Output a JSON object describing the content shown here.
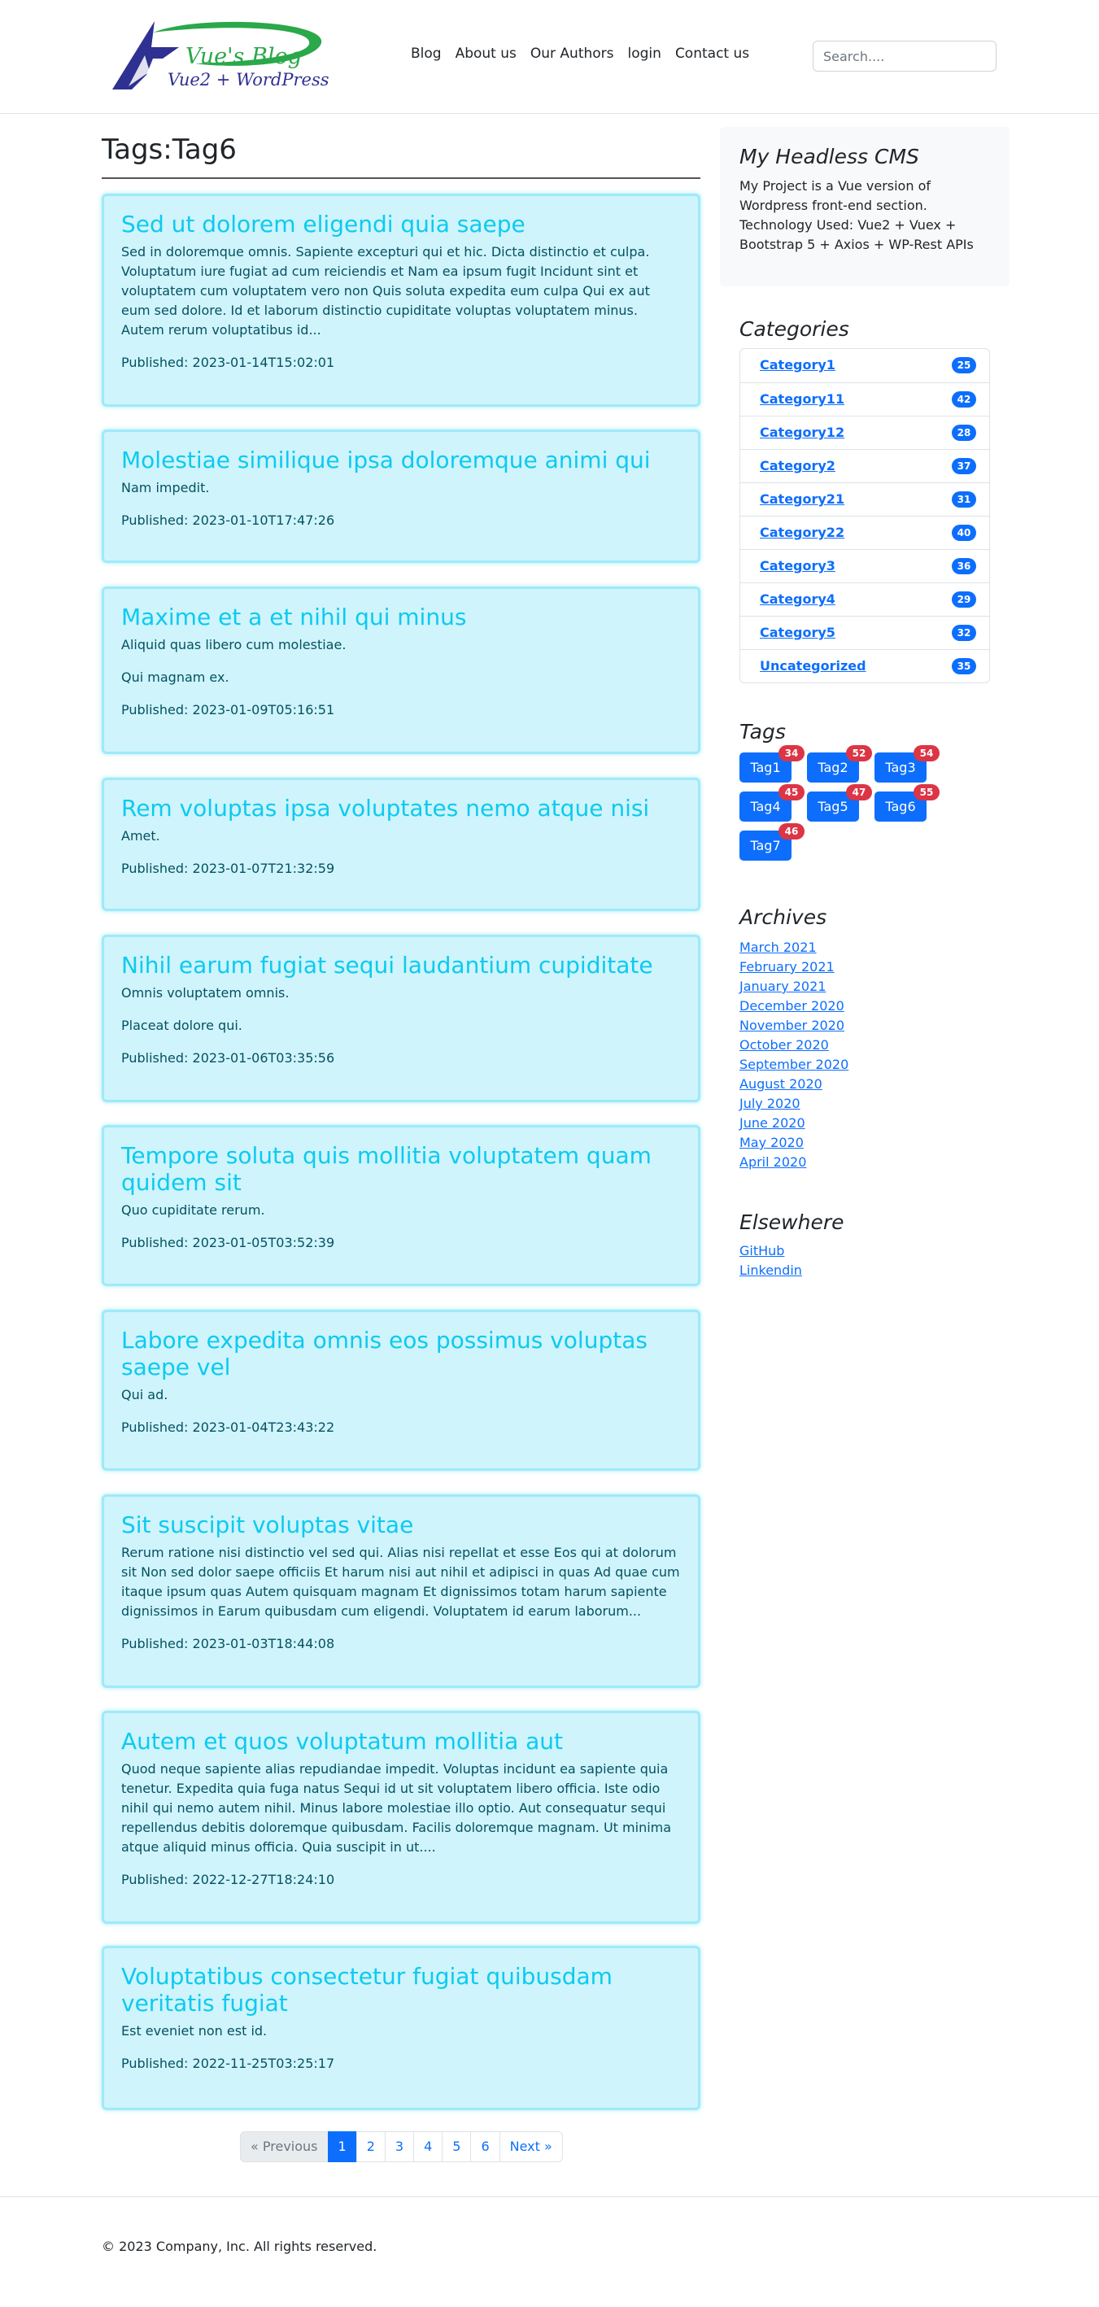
{
  "header": {
    "logo_title": "Vue's Blog",
    "logo_subtitle": "Vue2 + WordPress",
    "nav": [
      "Blog",
      "About us",
      "Our Authors",
      "login",
      "Contact us"
    ],
    "search_placeholder": "Search...."
  },
  "main": {
    "page_title": "Tags:Tag6",
    "posts": [
      {
        "title": "Sed ut dolorem eligendi quia saepe",
        "paragraphs": [
          "Sed in doloremque omnis. Sapiente excepturi qui et hic. Dicta distinctio et culpa. Voluptatum iure fugiat ad cum reiciendis et Nam ea ipsum fugit Incidunt sint et voluptatem cum voluptatem vero non Quis soluta expedita eum culpa Qui ex aut eum sed dolore. Id et laborum distinctio cupiditate voluptas voluptatem minus. Autem rerum voluptatibus id..."
        ],
        "published": "Published: 2023-01-14T15:02:01"
      },
      {
        "title": "Molestiae similique ipsa doloremque animi qui",
        "paragraphs": [
          "Nam impedit."
        ],
        "published": "Published: 2023-01-10T17:47:26"
      },
      {
        "title": "Maxime et a et nihil qui minus",
        "paragraphs": [
          "Aliquid quas libero cum molestiae.",
          "Qui magnam ex."
        ],
        "published": "Published: 2023-01-09T05:16:51"
      },
      {
        "title": "Rem voluptas ipsa voluptates nemo atque nisi",
        "paragraphs": [
          "Amet."
        ],
        "published": "Published: 2023-01-07T21:32:59"
      },
      {
        "title": "Nihil earum fugiat sequi laudantium cupiditate",
        "paragraphs": [
          "Omnis voluptatem omnis.",
          "Placeat dolore qui."
        ],
        "published": "Published: 2023-01-06T03:35:56"
      },
      {
        "title": "Tempore soluta quis mollitia voluptatem quam quidem sit",
        "paragraphs": [
          "Quo cupiditate rerum."
        ],
        "published": "Published: 2023-01-05T03:52:39"
      },
      {
        "title": "Labore expedita omnis eos possimus voluptas saepe vel",
        "paragraphs": [
          "Qui ad."
        ],
        "published": "Published: 2023-01-04T23:43:22"
      },
      {
        "title": "Sit suscipit voluptas vitae",
        "paragraphs": [
          "Rerum ratione nisi distinctio vel sed qui. Alias nisi repellat et esse Eos qui at dolorum sit Non sed dolor saepe officiis Et harum nisi aut nihil et adipisci in quas Ad quae cum itaque ipsum quas Autem quisquam magnam Et dignissimos totam harum sapiente dignissimos in Earum quibusdam cum eligendi. Voluptatem id earum laborum..."
        ],
        "published": "Published: 2023-01-03T18:44:08"
      },
      {
        "title": "Autem et quos voluptatum mollitia aut",
        "paragraphs": [
          "Quod neque sapiente alias repudiandae impedit. Voluptas incidunt ea sapiente quia tenetur. Expedita quia fuga natus Sequi id ut sit voluptatem libero officia. Iste odio nihil qui nemo autem nihil. Minus labore molestiae illo optio. Aut consequatur sequi repellendus debitis doloremque quibusdam. Facilis doloremque magnam. Ut minima atque aliquid minus officia. Quia suscipit in ut...."
        ],
        "published": "Published: 2022-12-27T18:24:10"
      },
      {
        "title": "Voluptatibus consectetur fugiat quibusdam veritatis fugiat",
        "paragraphs": [
          "Est eveniet non est id."
        ],
        "published": "Published: 2022-11-25T03:25:17"
      }
    ],
    "pagination": {
      "previous": "« Previous",
      "pages": [
        "1",
        "2",
        "3",
        "4",
        "5",
        "6"
      ],
      "active": "1",
      "next": "Next »"
    }
  },
  "sidebar": {
    "about_title": "My Headless CMS",
    "about_text": "My Project is a Vue version of Wordpress front-end section. Technology Used: Vue2 + Vuex + Bootstrap 5 + Axios + WP-Rest APIs",
    "categories_title": "Categories",
    "categories": [
      {
        "name": "Category1",
        "count": "25"
      },
      {
        "name": "Category11",
        "count": "42"
      },
      {
        "name": "Category12",
        "count": "28"
      },
      {
        "name": "Category2",
        "count": "37"
      },
      {
        "name": "Category21",
        "count": "31"
      },
      {
        "name": "Category22",
        "count": "40"
      },
      {
        "name": "Category3",
        "count": "36"
      },
      {
        "name": "Category4",
        "count": "29"
      },
      {
        "name": "Category5",
        "count": "32"
      },
      {
        "name": "Uncategorized",
        "count": "35"
      }
    ],
    "tags_title": "Tags",
    "tags": [
      {
        "name": "Tag1",
        "count": "34"
      },
      {
        "name": "Tag2",
        "count": "52"
      },
      {
        "name": "Tag3",
        "count": "54"
      },
      {
        "name": "Tag4",
        "count": "45"
      },
      {
        "name": "Tag5",
        "count": "47"
      },
      {
        "name": "Tag6",
        "count": "55"
      },
      {
        "name": "Tag7",
        "count": "46"
      }
    ],
    "archives_title": "Archives",
    "archives": [
      "March 2021",
      "February 2021",
      "January 2021",
      "December 2020",
      "November 2020",
      "October 2020",
      "September 2020",
      "August 2020",
      "July 2020",
      "June 2020",
      "May 2020",
      "April 2020"
    ],
    "elsewhere_title": "Elsewhere",
    "elsewhere": [
      "GitHub",
      "Linkendin"
    ]
  },
  "footer": {
    "copyright": "© 2023 Company, Inc. All rights reserved."
  },
  "colors": {
    "primary": "#0d6efd",
    "info_bg": "#cff4fc",
    "info_border": "#9eeaf9",
    "info_title": "#0dcaf0",
    "info_text": "#055160",
    "danger": "#dc3545",
    "logo_green": "#2aa84a",
    "logo_navy": "#2e3192"
  }
}
